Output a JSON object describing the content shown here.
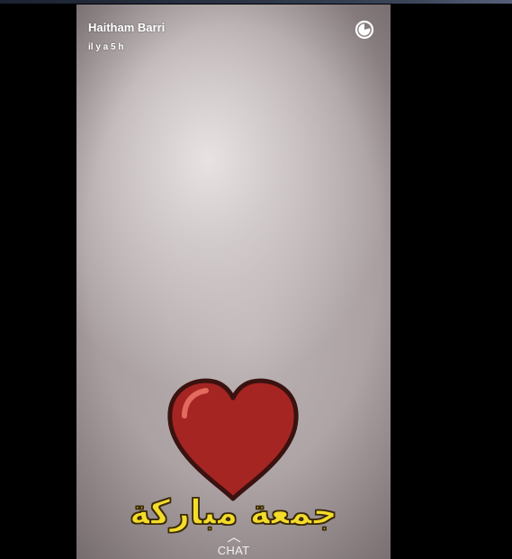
{
  "story": {
    "username": "Haitham Barri",
    "timestamp": "il y a 5 h",
    "timer_icon": "circular-timer-icon",
    "sticker_icon": "red-heart-icon",
    "caption": "جمعة مباركة",
    "chat_label": "CHAT",
    "chat_icon": "chevron-up-icon"
  },
  "colors": {
    "caption_fill": "#f4dc2a",
    "heart_fill": "#a52522",
    "background": "#000000"
  }
}
